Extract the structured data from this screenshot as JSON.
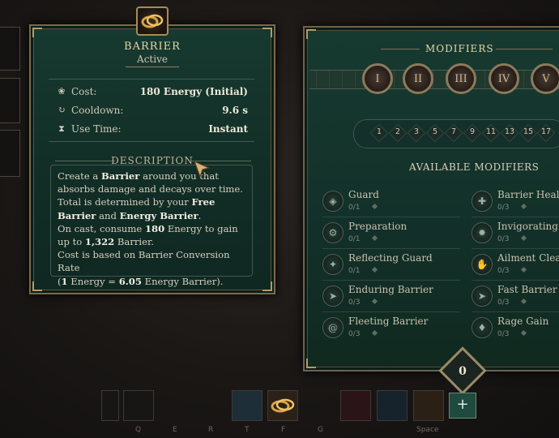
{
  "skill": {
    "title": "Barrier",
    "status": "Active",
    "stats": [
      {
        "icon": "energy-icon",
        "label": "Cost:",
        "value": "180 Energy (Initial)"
      },
      {
        "icon": "cooldown-icon",
        "label": "Cooldown:",
        "value": "9.6 s"
      },
      {
        "icon": "hourglass-icon",
        "label": "Use Time:",
        "value": "Instant"
      }
    ],
    "description_header": "Description",
    "description": {
      "l1a": "Create a ",
      "l1b": "Barrier",
      "l1c": " around you that absorbs damage and decays over time.",
      "l2a": "Total is determined by your ",
      "l2b": "Free Barrier",
      "l2c": " and ",
      "l2d": "Energy Barrier",
      "l2e": ".",
      "l3a": "On cast, consume ",
      "l3b": "180",
      "l3c": " Energy to gain up to ",
      "l3d": "1,322",
      "l3e": " Barrier.",
      "l4": "Cost is based on Barrier Conversion Rate",
      "l5a": "(",
      "l5b": "1",
      "l5c": " Energy = ",
      "l5d": "6.05",
      "l5e": " Energy Barrier)."
    }
  },
  "modifiers": {
    "title": "Modifiers",
    "tiers": [
      "I",
      "II",
      "III",
      "IV",
      "V"
    ],
    "levels": [
      "1",
      "2",
      "3",
      "5",
      "7",
      "9",
      "11",
      "13",
      "15",
      "17"
    ],
    "available_title": "Available Modifiers",
    "left": [
      {
        "name": "Guard",
        "count": "0/1"
      },
      {
        "name": "Preparation",
        "count": "0/1"
      },
      {
        "name": "Reflecting Guard",
        "count": "0/1"
      },
      {
        "name": "Enduring Barrier",
        "count": "0/3"
      },
      {
        "name": "Fleeting Barrier",
        "count": "0/3"
      }
    ],
    "right": [
      {
        "name": "Barrier Heal",
        "count": "0/3"
      },
      {
        "name": "Invigorating Gu",
        "count": "0/3"
      },
      {
        "name": "Ailment Cleans",
        "count": "0/3"
      },
      {
        "name": "Fast Barrier",
        "count": "0/3"
      },
      {
        "name": "Rage Gain",
        "count": "0/3"
      }
    ],
    "points": "0",
    "add_label": "+"
  },
  "hotbar": {
    "keys": [
      "Q",
      "E",
      "R",
      "T",
      "F",
      "G",
      "Space"
    ]
  },
  "colors": {
    "panel": "#153a30",
    "gold": "#b39a66",
    "text": "#d9d4c8"
  }
}
